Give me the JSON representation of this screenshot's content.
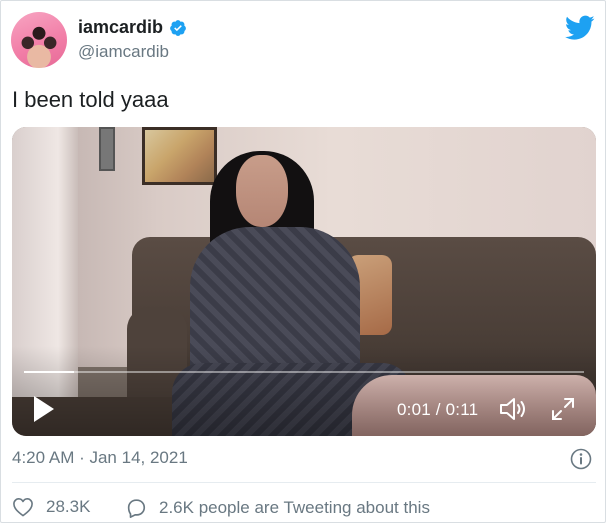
{
  "author": {
    "display_name": "iamcardib",
    "handle": "@iamcardib",
    "verified": true,
    "avatar_icon": "avatar-photo"
  },
  "brand_icon": "twitter-bird-icon",
  "colors": {
    "brand_blue": "#1da1f2",
    "text_primary": "#1c2022",
    "text_secondary": "#697882"
  },
  "tweet": {
    "text": "I been told yaaa"
  },
  "video": {
    "current_time": "0:01",
    "duration": "0:11",
    "time_display": "0:01 / 0:11",
    "progress": 0.09,
    "play_icon": "play-icon",
    "volume_icon": "volume-icon",
    "fullscreen_icon": "fullscreen-icon"
  },
  "meta": {
    "timestamp": "4:20 AM · Jan 14, 2021",
    "info_icon": "info-icon"
  },
  "actions": {
    "likes_count": "28.3K",
    "conversation_text": "2.6K people are Tweeting about this"
  }
}
